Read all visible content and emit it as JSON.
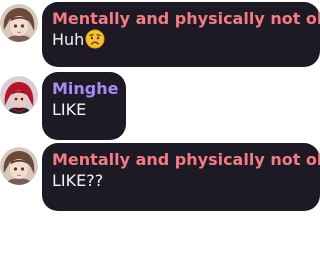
{
  "messages": [
    {
      "author": "Mentally and physically not ok.",
      "text": "Huh",
      "emoji": "worried-face-emoji",
      "name_color": "#f27c84",
      "avatar": "girl-brown-hair-avatar"
    },
    {
      "author": "Minghe",
      "text": "LIKE",
      "name_color": "#a58cf0",
      "avatar": "red-hair-dark-avatar"
    },
    {
      "author": "Mentally and physically not ok.",
      "text": "LIKE??",
      "name_color": "#f27c84",
      "avatar": "girl-brown-hair-avatar"
    }
  ],
  "colors": {
    "bubble": "#1d1a26",
    "text": "#f2f2f2",
    "background": "#ffffff"
  }
}
